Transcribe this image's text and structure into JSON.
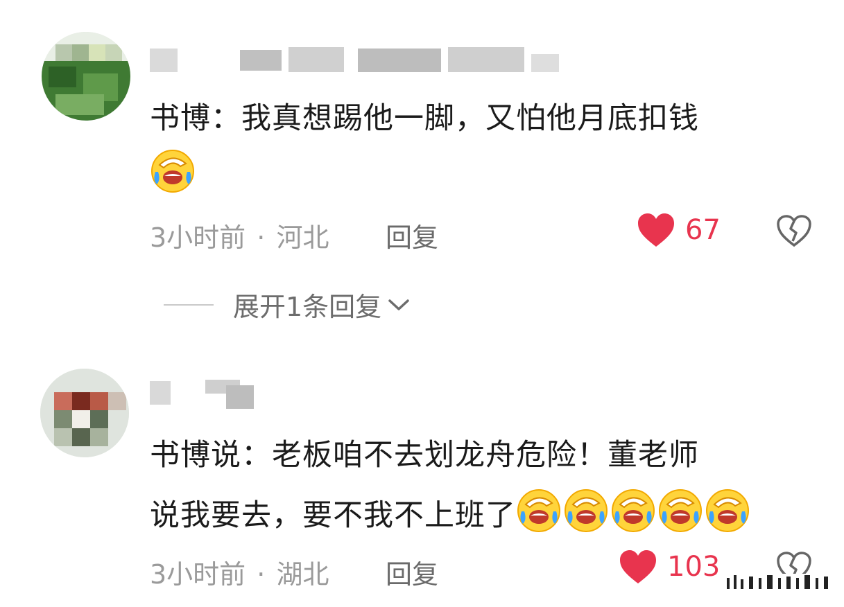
{
  "comments": [
    {
      "text_line1": "书博：我真想踢他一脚，又怕他月底扣钱",
      "emoji_name": "laughing-crying-emoji",
      "time": "3小时前",
      "separator": "·",
      "location": "河北",
      "reply_label": "回复",
      "likes": "67"
    },
    {
      "text_line1": "书博说：老板咱不去划龙舟危险！董老师",
      "text_line2": "说我要去，要不我不上班了",
      "emoji_name": "laughing-crying-emoji",
      "emoji_count": 5,
      "time": "3小时前",
      "separator": "·",
      "location": "湖北",
      "reply_label": "回复",
      "likes": "103"
    }
  ],
  "expand_replies": {
    "label": "展开1条回复"
  },
  "colors": {
    "like_heart": "#e8344e",
    "meta_text": "#9a9a9a",
    "body_text": "#1b1b1b"
  }
}
